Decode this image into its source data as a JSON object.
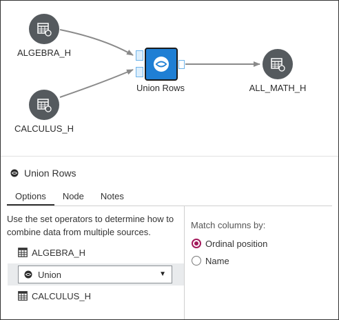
{
  "flow": {
    "nodes": {
      "algebra": {
        "label": "ALGEBRA_H",
        "icon": "table-icon"
      },
      "calculus": {
        "label": "CALCULUS_H",
        "icon": "table-icon"
      },
      "union": {
        "label": "Union Rows",
        "icon": "union-icon"
      },
      "output": {
        "label": "ALL_MATH_H",
        "icon": "table-icon"
      }
    }
  },
  "pane": {
    "title": "Union Rows",
    "tabs": [
      {
        "label": "Options",
        "active": true
      },
      {
        "label": "Node",
        "active": false
      },
      {
        "label": "Notes",
        "active": false
      }
    ],
    "options": {
      "description": "Use the set operators to determine how to combine data from multiple sources.",
      "sources": [
        "ALGEBRA_H",
        "CALCULUS_H"
      ],
      "operator": {
        "selected": "Union"
      },
      "match": {
        "label": "Match columns by:",
        "choices": [
          {
            "label": "Ordinal position",
            "checked": true
          },
          {
            "label": "Name",
            "checked": false
          }
        ]
      }
    }
  },
  "colors": {
    "accent": "#1f7fd4",
    "node_fill": "#555a5e",
    "radio_selected": "#a3195b",
    "edge": "#8a8a8a"
  }
}
